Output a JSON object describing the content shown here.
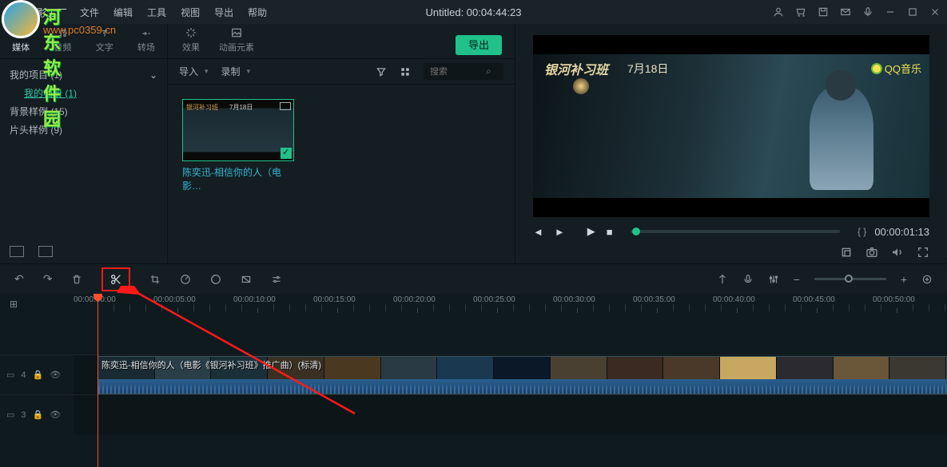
{
  "app": {
    "title": "喵影工厂"
  },
  "menu": [
    "文件",
    "编辑",
    "工具",
    "视图",
    "导出",
    "帮助"
  ],
  "doc_title": "Untitled: 00:04:44:23",
  "watermark": {
    "site": "河东软件园",
    "url": "www.pc0359.cn"
  },
  "left_tabs": [
    {
      "label": "媒体"
    },
    {
      "label": "音频"
    },
    {
      "label": "文字"
    },
    {
      "label": "转场"
    }
  ],
  "center_tabs": [
    {
      "label": "效果"
    },
    {
      "label": "动画元素"
    }
  ],
  "export_label": "导出",
  "tree": {
    "project": "我的项目 (1)",
    "album": "我的相册 (1)",
    "bg": "背景样例 (15)",
    "intro": "片头样例 (9)"
  },
  "media_toolbar": {
    "import": "导入",
    "record": "录制"
  },
  "search_placeholder": "搜索",
  "clip": {
    "name": "陈奕迅-相信你的人（电影…",
    "tag": "银河补习班",
    "sub": "7月18日"
  },
  "preview": {
    "title_text": "银河补习班",
    "date_text": "7月18日",
    "brand": "QQ音乐",
    "timecode": "00:00:01:13",
    "braces": "{  }"
  },
  "ruler_ticks": [
    "00:00:00:00",
    "00:00:05:00",
    "00:00:10:00",
    "00:00:15:00",
    "00:00:20:00",
    "00:00:25:00",
    "00:00:30:00",
    "00:00:35:00",
    "00:00:40:00",
    "00:00:45:00",
    "00:00:50:00"
  ],
  "track4_label": "4",
  "track3_label": "3",
  "video_clip_title": "陈奕迅-相信你的人（电影《银河补习班》推广曲）(标清)"
}
